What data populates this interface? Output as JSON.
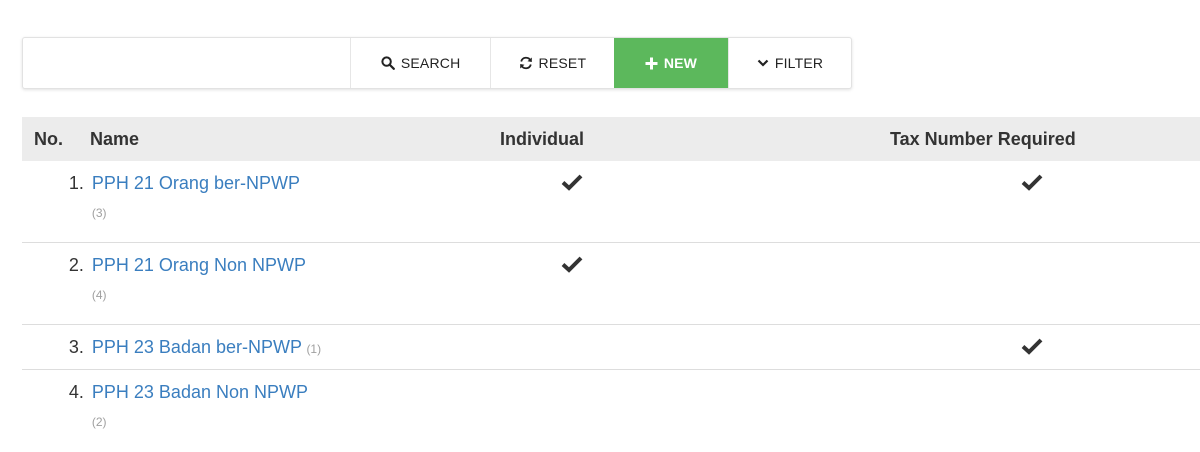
{
  "toolbar": {
    "search_placeholder": "",
    "search_label": "SEARCH",
    "reset_label": "RESET",
    "new_label": "NEW",
    "filter_label": "FILTER",
    "new_color": "#5cb85c"
  },
  "table": {
    "headers": {
      "no": "No.",
      "name": "Name",
      "individual": "Individual",
      "tax_required": "Tax Number Required"
    },
    "rows": [
      {
        "no": "1.",
        "name": "PPH 21 Orang ber-NPWP",
        "count": "(3)",
        "individual": true,
        "tax_required": true
      },
      {
        "no": "2.",
        "name": "PPH 21 Orang Non NPWP",
        "count": "(4)",
        "individual": true,
        "tax_required": false
      },
      {
        "no": "3.",
        "name": "PPH 23 Badan ber-NPWP",
        "count": "(1)",
        "individual": false,
        "tax_required": true
      },
      {
        "no": "4.",
        "name": "PPH 23 Badan Non NPWP",
        "count": "(2)",
        "individual": false,
        "tax_required": false
      }
    ]
  },
  "colors": {
    "link": "#3a7ebf",
    "header_bg": "#ececec",
    "check": "#333333"
  }
}
